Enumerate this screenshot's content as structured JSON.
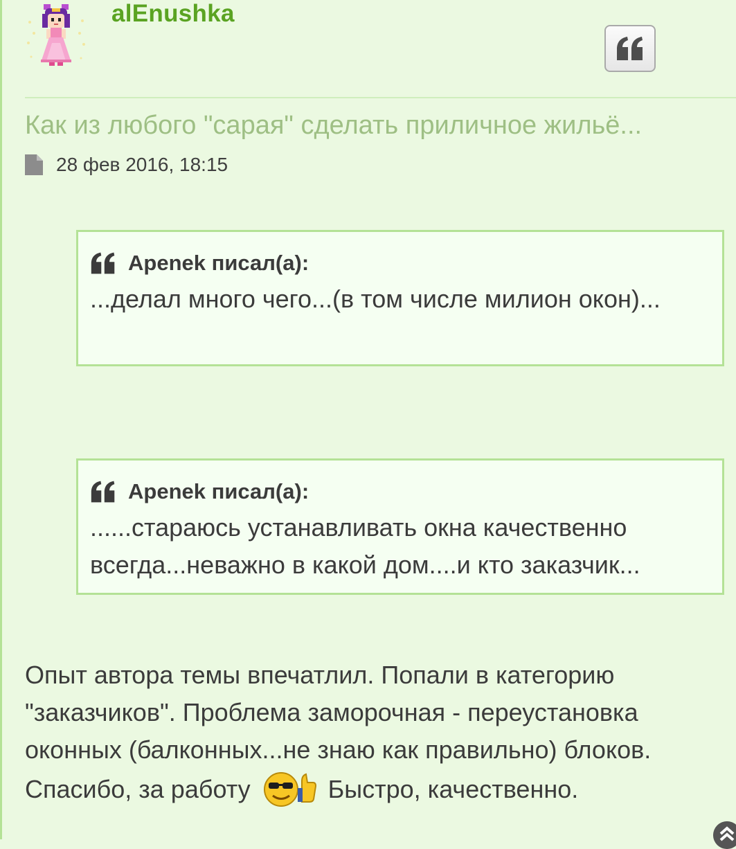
{
  "post": {
    "username": "alEnushka",
    "topic_title": "Как из любого \"сарая\" сделать приличное жильё...",
    "date": "28 фев 2016, 18:15",
    "quotes": [
      {
        "author": "Apenek писал(а):",
        "text": "...делал много чего...(в том числе милион окон)..."
      },
      {
        "author": "Apenek писал(а):",
        "text": "......стараюсь устанавливать окна качественно всегда...неважно в какой дом....и кто заказчик..."
      }
    ],
    "body_part1": "Опыт автора темы впечатлил. Попали в категорию \"заказчиков\". Проблема заморочная - переустановка оконных (балконных...не знаю как правильно) блоков. Спасибо, за работу",
    "body_part2": "Быстро, качественно."
  },
  "colors": {
    "page_bg": "#ebf9e1",
    "accent_green": "#5aa322",
    "title_green": "#9ebf84",
    "quote_border": "#b4e296",
    "quote_bg": "#f5fff2"
  },
  "icons": {
    "quote_button": "quote-icon",
    "date": "file-icon",
    "smiley": "cool-thumbs-up-smiley",
    "scroll": "chevron-up-icon"
  }
}
